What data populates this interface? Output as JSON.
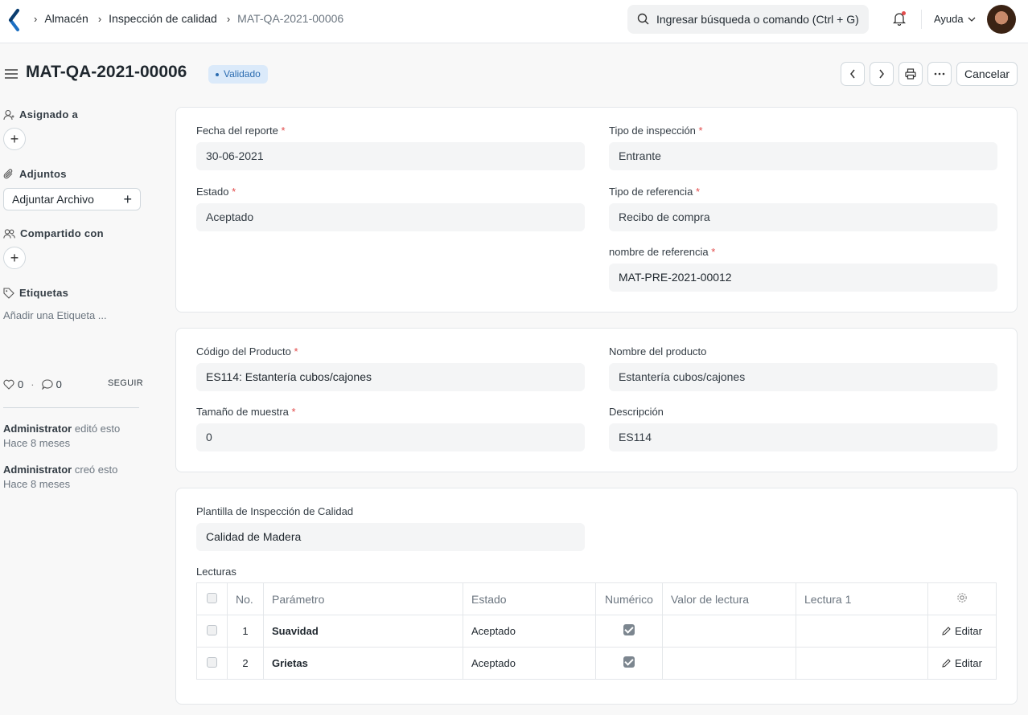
{
  "breadcrumbs": [
    "Almacén",
    "Inspección de calidad",
    "MAT-QA-2021-00006"
  ],
  "search": {
    "placeholder": "Ingresar búsqueda o comando (Ctrl + G)"
  },
  "help_label": "Ayuda",
  "page": {
    "title": "MAT-QA-2021-00006",
    "status": "Validado",
    "cancel_label": "Cancelar"
  },
  "sidebar": {
    "assigned_label": "Asignado a",
    "attachments_label": "Adjuntos",
    "attach_button": "Adjuntar Archivo",
    "shared_label": "Compartido con",
    "tags_label": "Etiquetas",
    "add_tag": "Añadir una Etiqueta ...",
    "likes": "0",
    "comments": "0",
    "follow": "SEGUIR",
    "activity": [
      {
        "user": "Administrator",
        "action": "editó esto",
        "time": "Hace 8 meses"
      },
      {
        "user": "Administrator",
        "action": "creó esto",
        "time": "Hace 8 meses"
      }
    ]
  },
  "section1": {
    "report_date_label": "Fecha del reporte",
    "report_date": "30-06-2021",
    "inspection_type_label": "Tipo de inspección",
    "inspection_type": "Entrante",
    "status_label": "Estado",
    "status": "Aceptado",
    "reference_type_label": "Tipo de referencia",
    "reference_type": "Recibo de compra",
    "reference_name_label": "nombre de referencia",
    "reference_name": "MAT-PRE-2021-00012"
  },
  "section2": {
    "item_code_label": "Código del Producto",
    "item_code": "ES114: Estantería cubos/cajones",
    "item_name_label": "Nombre del producto",
    "item_name": "Estantería cubos/cajones",
    "sample_size_label": "Tamaño de muestra",
    "sample_size": "0",
    "description_label": "Descripción",
    "description": "ES114"
  },
  "section3": {
    "template_label": "Plantilla de Inspección de Calidad",
    "template": "Calidad de Madera",
    "readings_label": "Lecturas",
    "columns": [
      "No.",
      "Parámetro",
      "Estado",
      "Numérico",
      "Valor de lectura",
      "Lectura 1"
    ],
    "rows": [
      {
        "no": "1",
        "parameter": "Suavidad",
        "status": "Aceptado",
        "numeric": true
      },
      {
        "no": "2",
        "parameter": "Grietas",
        "status": "Aceptado",
        "numeric": true
      }
    ],
    "edit_label": "Editar"
  }
}
